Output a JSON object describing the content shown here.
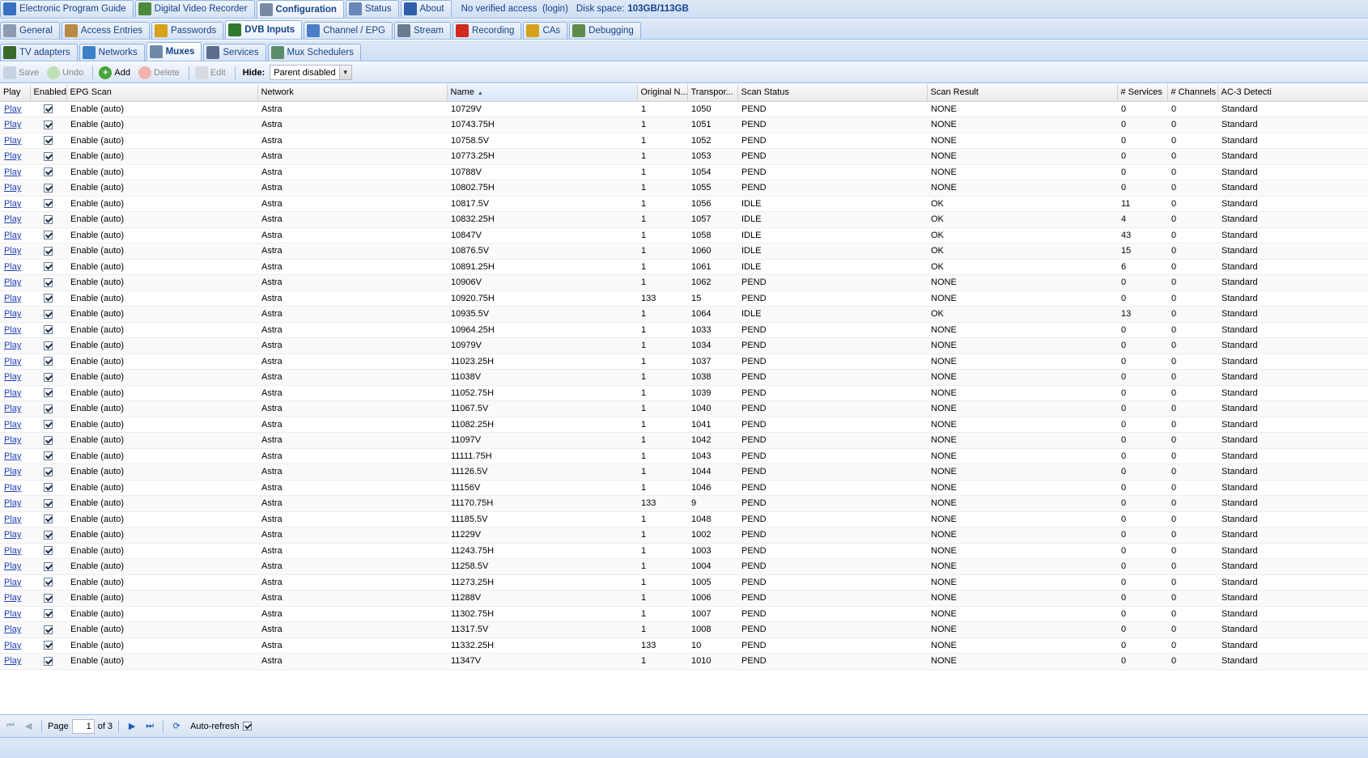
{
  "top_tabs": [
    {
      "label": "Electronic Program Guide",
      "icon": "epg-icon",
      "color": "#3a6fc2",
      "active": false
    },
    {
      "label": "Digital Video Recorder",
      "icon": "dvr-icon",
      "color": "#4b8a3c",
      "active": false
    },
    {
      "label": "Configuration",
      "icon": "wrench-icon",
      "color": "#7a8aa5",
      "active": true
    },
    {
      "label": "Status",
      "icon": "eye-icon",
      "color": "#6b86b8",
      "active": false
    },
    {
      "label": "About",
      "icon": "info-icon",
      "color": "#2f5faa",
      "active": false
    }
  ],
  "access": {
    "text": "No verified access",
    "login": "(login)"
  },
  "disk": {
    "label": "Disk space:",
    "value": "103GB/113GB"
  },
  "config_tabs": [
    {
      "label": "General",
      "icon": "tools-icon",
      "color": "#8e9bb2",
      "active": false
    },
    {
      "label": "Access Entries",
      "icon": "users-icon",
      "color": "#b88a45",
      "active": false
    },
    {
      "label": "Passwords",
      "icon": "lock-icon",
      "color": "#d7a21b",
      "active": false
    },
    {
      "label": "DVB Inputs",
      "icon": "card-icon",
      "color": "#2f7a2c",
      "active": true
    },
    {
      "label": "Channel / EPG",
      "icon": "tv-icon",
      "color": "#4a7ec9",
      "active": false
    },
    {
      "label": "Stream",
      "icon": "stream-icon",
      "color": "#6a7d8e",
      "active": false
    },
    {
      "label": "Recording",
      "icon": "rec-icon",
      "color": "#d12a1f",
      "active": false
    },
    {
      "label": "CAs",
      "icon": "key-icon",
      "color": "#d7a21b",
      "active": false
    },
    {
      "label": "Debugging",
      "icon": "bug-icon",
      "color": "#5f8c4a",
      "active": false
    }
  ],
  "dvb_tabs": [
    {
      "label": "TV adapters",
      "icon": "adapter-icon",
      "color": "#3b6a2c",
      "active": false
    },
    {
      "label": "Networks",
      "icon": "antenna-icon",
      "color": "#3d7fc9",
      "active": false
    },
    {
      "label": "Muxes",
      "icon": "dish-icon",
      "color": "#6f8aa8",
      "active": true
    },
    {
      "label": "Services",
      "icon": "services-icon",
      "color": "#5a6e8c",
      "active": false
    },
    {
      "label": "Mux Schedulers",
      "icon": "scheduler-icon",
      "color": "#5a8c6a",
      "active": false
    }
  ],
  "toolbar": {
    "save": "Save",
    "undo": "Undo",
    "add": "Add",
    "delete": "Delete",
    "edit": "Edit",
    "hide_label": "Hide:",
    "hide_value": "Parent disabled"
  },
  "columns": [
    "Play",
    "Enabled",
    "EPG Scan",
    "Network",
    "Name",
    "Original N...",
    "Transpor...",
    "Scan Status",
    "Scan Result",
    "# Services",
    "# Channels",
    "AC-3 Detecti"
  ],
  "rows": [
    [
      "10729V",
      "1",
      "1050",
      "PEND",
      "NONE",
      "0",
      "0"
    ],
    [
      "10743.75H",
      "1",
      "1051",
      "PEND",
      "NONE",
      "0",
      "0"
    ],
    [
      "10758.5V",
      "1",
      "1052",
      "PEND",
      "NONE",
      "0",
      "0"
    ],
    [
      "10773.25H",
      "1",
      "1053",
      "PEND",
      "NONE",
      "0",
      "0"
    ],
    [
      "10788V",
      "1",
      "1054",
      "PEND",
      "NONE",
      "0",
      "0"
    ],
    [
      "10802.75H",
      "1",
      "1055",
      "PEND",
      "NONE",
      "0",
      "0"
    ],
    [
      "10817.5V",
      "1",
      "1056",
      "IDLE",
      "OK",
      "11",
      "0"
    ],
    [
      "10832.25H",
      "1",
      "1057",
      "IDLE",
      "OK",
      "4",
      "0"
    ],
    [
      "10847V",
      "1",
      "1058",
      "IDLE",
      "OK",
      "43",
      "0"
    ],
    [
      "10876.5V",
      "1",
      "1060",
      "IDLE",
      "OK",
      "15",
      "0"
    ],
    [
      "10891.25H",
      "1",
      "1061",
      "IDLE",
      "OK",
      "6",
      "0"
    ],
    [
      "10906V",
      "1",
      "1062",
      "PEND",
      "NONE",
      "0",
      "0"
    ],
    [
      "10920.75H",
      "133",
      "15",
      "PEND",
      "NONE",
      "0",
      "0"
    ],
    [
      "10935.5V",
      "1",
      "1064",
      "IDLE",
      "OK",
      "13",
      "0"
    ],
    [
      "10964.25H",
      "1",
      "1033",
      "PEND",
      "NONE",
      "0",
      "0"
    ],
    [
      "10979V",
      "1",
      "1034",
      "PEND",
      "NONE",
      "0",
      "0"
    ],
    [
      "11023.25H",
      "1",
      "1037",
      "PEND",
      "NONE",
      "0",
      "0"
    ],
    [
      "11038V",
      "1",
      "1038",
      "PEND",
      "NONE",
      "0",
      "0"
    ],
    [
      "11052.75H",
      "1",
      "1039",
      "PEND",
      "NONE",
      "0",
      "0"
    ],
    [
      "11067.5V",
      "1",
      "1040",
      "PEND",
      "NONE",
      "0",
      "0"
    ],
    [
      "11082.25H",
      "1",
      "1041",
      "PEND",
      "NONE",
      "0",
      "0"
    ],
    [
      "11097V",
      "1",
      "1042",
      "PEND",
      "NONE",
      "0",
      "0"
    ],
    [
      "11111.75H",
      "1",
      "1043",
      "PEND",
      "NONE",
      "0",
      "0"
    ],
    [
      "11126.5V",
      "1",
      "1044",
      "PEND",
      "NONE",
      "0",
      "0"
    ],
    [
      "11156V",
      "1",
      "1046",
      "PEND",
      "NONE",
      "0",
      "0"
    ],
    [
      "11170.75H",
      "133",
      "9",
      "PEND",
      "NONE",
      "0",
      "0"
    ],
    [
      "11185.5V",
      "1",
      "1048",
      "PEND",
      "NONE",
      "0",
      "0"
    ],
    [
      "11229V",
      "1",
      "1002",
      "PEND",
      "NONE",
      "0",
      "0"
    ],
    [
      "11243.75H",
      "1",
      "1003",
      "PEND",
      "NONE",
      "0",
      "0"
    ],
    [
      "11258.5V",
      "1",
      "1004",
      "PEND",
      "NONE",
      "0",
      "0"
    ],
    [
      "11273.25H",
      "1",
      "1005",
      "PEND",
      "NONE",
      "0",
      "0"
    ],
    [
      "11288V",
      "1",
      "1006",
      "PEND",
      "NONE",
      "0",
      "0"
    ],
    [
      "11302.75H",
      "1",
      "1007",
      "PEND",
      "NONE",
      "0",
      "0"
    ],
    [
      "11317.5V",
      "1",
      "1008",
      "PEND",
      "NONE",
      "0",
      "0"
    ],
    [
      "11332.25H",
      "133",
      "10",
      "PEND",
      "NONE",
      "0",
      "0"
    ],
    [
      "11347V",
      "1",
      "1010",
      "PEND",
      "NONE",
      "0",
      "0"
    ]
  ],
  "row_common": {
    "play": "Play",
    "epg": "Enable (auto)",
    "network": "Astra",
    "ac3": "Standard"
  },
  "pager": {
    "page_label": "Page",
    "page": "1",
    "of": "of 3",
    "auto_refresh": "Auto-refresh"
  }
}
